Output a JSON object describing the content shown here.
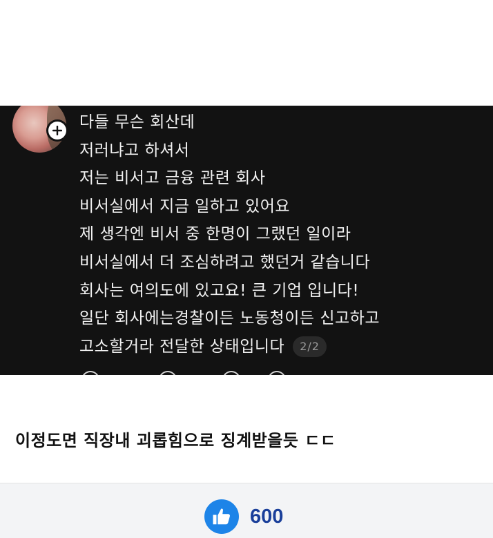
{
  "comment": {
    "lines": [
      "다들 무슨 회산데",
      "저러냐고 하셔서",
      "저는 비서고 금융 관련 회사",
      "비서실에서 지금 일하고 있어요",
      "제 생각엔 비서 중 한명이 그랬던 일이라",
      "비서실에서 더 조심하려고 했던거 같습니다",
      "회사는 여의도에 있고요! 큰 기업 입니다!",
      "일단 회사에는경찰이든 노동청이든 신고하고",
      "고소할거라 전달한 상태입니다"
    ],
    "page_indicator": "2/2"
  },
  "caption": "이정도면 직장내 괴롭힘으로 징계받을듯 ㄷㄷ",
  "like": {
    "count": "600",
    "icon": "thumbs-up-icon",
    "color": "#1d84e8"
  }
}
